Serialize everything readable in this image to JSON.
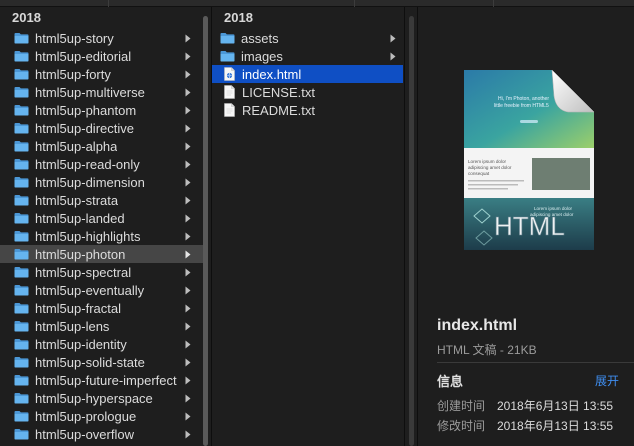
{
  "window": {},
  "column1": {
    "header": "2018",
    "items": [
      {
        "label": "html5up-story"
      },
      {
        "label": "html5up-editorial"
      },
      {
        "label": "html5up-forty"
      },
      {
        "label": "html5up-multiverse"
      },
      {
        "label": "html5up-phantom"
      },
      {
        "label": "html5up-directive"
      },
      {
        "label": "html5up-alpha"
      },
      {
        "label": "html5up-read-only"
      },
      {
        "label": "html5up-dimension"
      },
      {
        "label": "html5up-strata"
      },
      {
        "label": "html5up-landed"
      },
      {
        "label": "html5up-highlights"
      },
      {
        "label": "html5up-photon",
        "selected": true
      },
      {
        "label": "html5up-spectral"
      },
      {
        "label": "html5up-eventually"
      },
      {
        "label": "html5up-fractal"
      },
      {
        "label": "html5up-lens"
      },
      {
        "label": "html5up-identity"
      },
      {
        "label": "html5up-solid-state"
      },
      {
        "label": "html5up-future-imperfect"
      },
      {
        "label": "html5up-hyperspace"
      },
      {
        "label": "html5up-prologue"
      },
      {
        "label": "html5up-overflow"
      }
    ]
  },
  "column2": {
    "header": "2018",
    "items": [
      {
        "label": "assets",
        "type": "folder"
      },
      {
        "label": "images",
        "type": "folder"
      },
      {
        "label": "index.html",
        "type": "html",
        "selected": true
      },
      {
        "label": "LICENSE.txt",
        "type": "text"
      },
      {
        "label": "README.txt",
        "type": "text"
      }
    ]
  },
  "preview": {
    "thumbnail_text": {
      "hero_line1": "Hi, I'm Photon, another",
      "hero_line2": "little freebie from HTML5",
      "body_line1": "Lorem ipsum dolor",
      "body_line2": "adipiscing amet dolor",
      "body_line3": "consequat",
      "footer_line1": "Lorem ipsum dolor",
      "footer_line2": "adipiscing amet dolor",
      "badge": "HTML"
    },
    "filename": "index.html",
    "kind": "HTML 文稿 - 21KB",
    "info_label": "信息",
    "more_label": "展开",
    "meta": [
      {
        "key": "创建时间",
        "value": "2018年6月13日 13:55"
      },
      {
        "key": "修改时间",
        "value": "2018年6月13日 13:55"
      }
    ]
  },
  "colors": {
    "folder": "#5aa7e6",
    "selection_blue": "#0f4fc4",
    "selection_gray": "#464646",
    "accent_link": "#3f8ef0"
  },
  "icons": {
    "folder": "folder-icon",
    "html_file": "html-file-icon",
    "text_file": "text-file-icon",
    "chevron": "chevron-right-icon"
  }
}
